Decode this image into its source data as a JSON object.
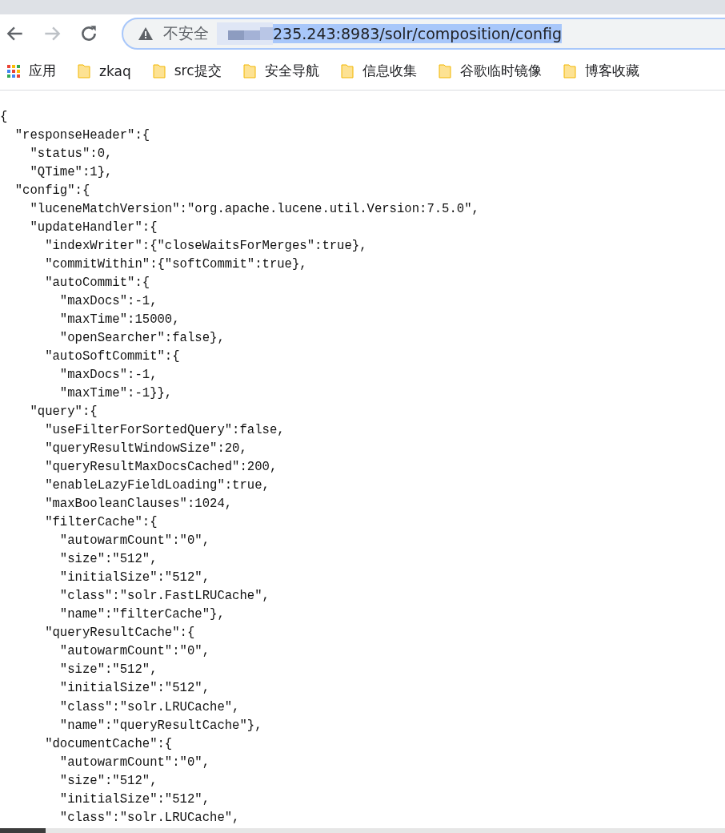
{
  "toolbar": {
    "security_label": "不安全",
    "url": "235.243:8983/solr/composition/config",
    "url_selected": true
  },
  "bookmarks": [
    {
      "kind": "apps",
      "label": "应用"
    },
    {
      "kind": "folder",
      "label": "zkaq"
    },
    {
      "kind": "folder",
      "label": "src提交"
    },
    {
      "kind": "folder",
      "label": "安全导航"
    },
    {
      "kind": "folder",
      "label": "信息收集"
    },
    {
      "kind": "folder",
      "label": "谷歌临时镜像"
    },
    {
      "kind": "folder",
      "label": "博客收藏"
    }
  ],
  "document_lines": [
    "{",
    "  \"responseHeader\":{",
    "    \"status\":0,",
    "    \"QTime\":1},",
    "  \"config\":{",
    "    \"luceneMatchVersion\":\"org.apache.lucene.util.Version:7.5.0\",",
    "    \"updateHandler\":{",
    "      \"indexWriter\":{\"closeWaitsForMerges\":true},",
    "      \"commitWithin\":{\"softCommit\":true},",
    "      \"autoCommit\":{",
    "        \"maxDocs\":-1,",
    "        \"maxTime\":15000,",
    "        \"openSearcher\":false},",
    "      \"autoSoftCommit\":{",
    "        \"maxDocs\":-1,",
    "        \"maxTime\":-1}},",
    "    \"query\":{",
    "      \"useFilterForSortedQuery\":false,",
    "      \"queryResultWindowSize\":20,",
    "      \"queryResultMaxDocsCached\":200,",
    "      \"enableLazyFieldLoading\":true,",
    "      \"maxBooleanClauses\":1024,",
    "      \"filterCache\":{",
    "        \"autowarmCount\":\"0\",",
    "        \"size\":\"512\",",
    "        \"initialSize\":\"512\",",
    "        \"class\":\"solr.FastLRUCache\",",
    "        \"name\":\"filterCache\"},",
    "      \"queryResultCache\":{",
    "        \"autowarmCount\":\"0\",",
    "        \"size\":\"512\",",
    "        \"initialSize\":\"512\",",
    "        \"class\":\"solr.LRUCache\",",
    "        \"name\":\"queryResultCache\"},",
    "      \"documentCache\":{",
    "        \"autowarmCount\":\"0\",",
    "        \"size\":\"512\",",
    "        \"initialSize\":\"512\",",
    "        \"class\":\"solr.LRUCache\","
  ]
}
